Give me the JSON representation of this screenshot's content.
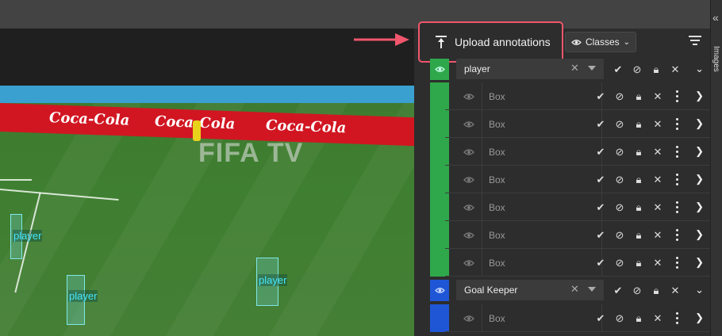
{
  "toolbar": {
    "upload_label": "Upload annotations",
    "classes_label": "Classes"
  },
  "canvas": {
    "ad_text": "Coca-Cola",
    "watermark": "FIFA TV",
    "boxes": [
      {
        "label": "player"
      },
      {
        "label": "player"
      },
      {
        "label": "player"
      }
    ]
  },
  "rail": {
    "label": "Images"
  },
  "classes": [
    {
      "name": "player",
      "color": "#2ea84a",
      "objects": [
        {
          "label": "Box"
        },
        {
          "label": "Box"
        },
        {
          "label": "Box"
        },
        {
          "label": "Box"
        },
        {
          "label": "Box"
        },
        {
          "label": "Box"
        },
        {
          "label": "Box"
        }
      ]
    },
    {
      "name": "Goal Keeper",
      "color": "#1f56d6",
      "objects": [
        {
          "label": "Box"
        }
      ]
    }
  ]
}
